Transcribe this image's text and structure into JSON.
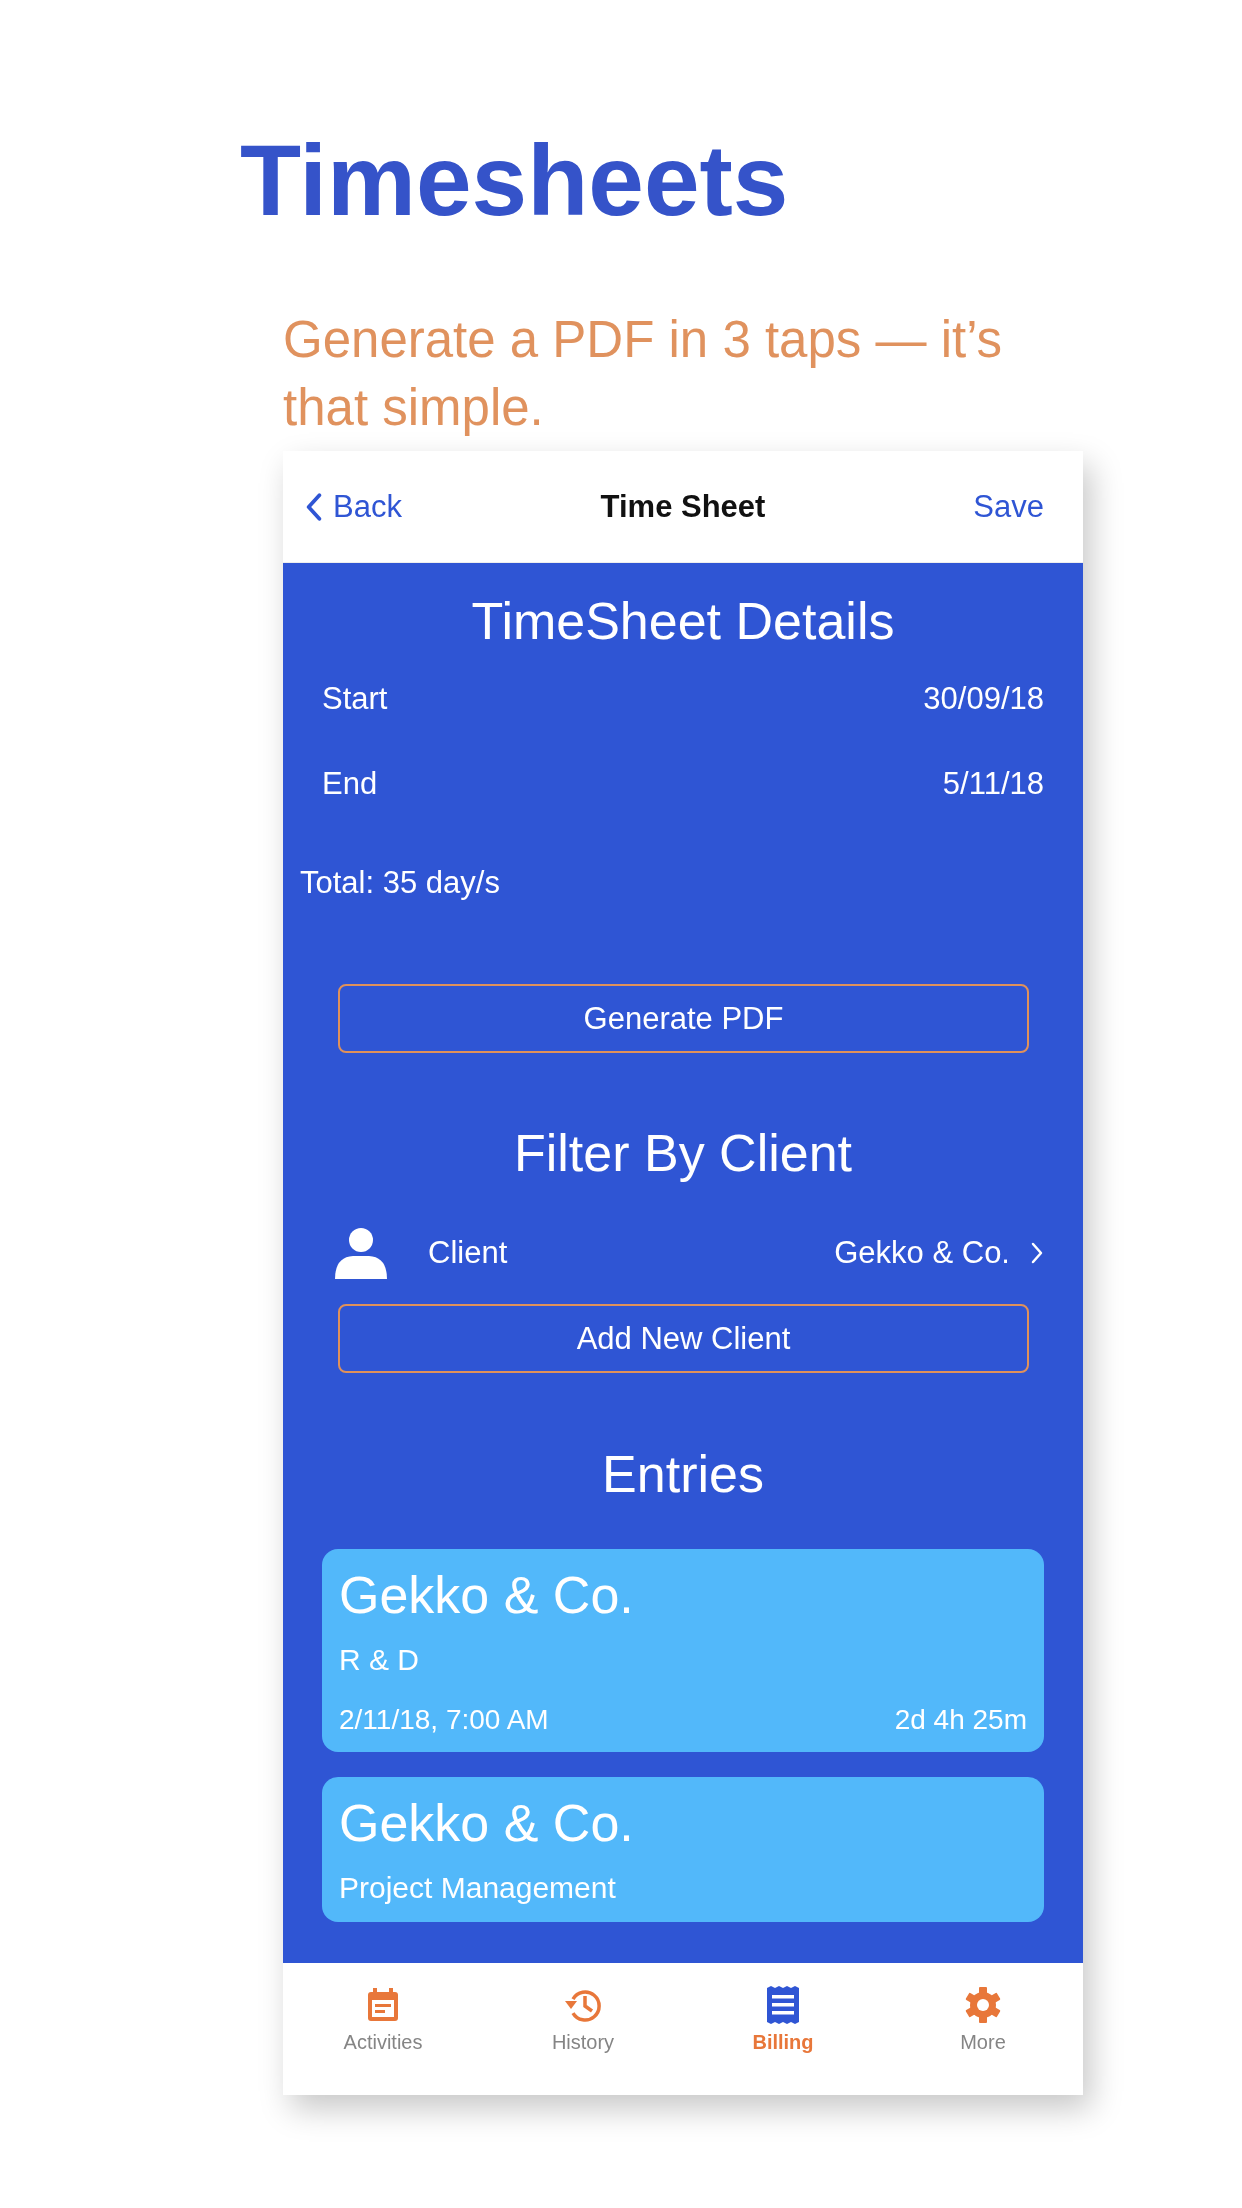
{
  "headline": "Timesheets",
  "subtitle": "Generate a PDF in 3 taps — it’s that simple.",
  "nav": {
    "back": "Back",
    "title": "Time Sheet",
    "action": "Save"
  },
  "details": {
    "heading": "TimeSheet Details",
    "rows": [
      {
        "label": "Start",
        "value": "30/09/18"
      },
      {
        "label": "End",
        "value": "5/11/18"
      }
    ],
    "total": "Total: 35 day/s",
    "button": "Generate PDF"
  },
  "filter": {
    "heading": "Filter By Client",
    "label": "Client",
    "value": "Gekko & Co.",
    "button": "Add New Client"
  },
  "entries": {
    "heading": "Entries",
    "items": [
      {
        "client": "Gekko & Co.",
        "project": "R & D",
        "date": "2/11/18, 7:00 AM",
        "duration": "2d 4h 25m"
      },
      {
        "client": "Gekko & Co.",
        "project": "Project Management"
      }
    ]
  },
  "tabs": [
    {
      "kind": "calendar",
      "label": "Activities",
      "selected": false
    },
    {
      "kind": "history",
      "label": "History",
      "selected": false
    },
    {
      "kind": "billing",
      "label": "Billing",
      "selected": true
    },
    {
      "kind": "more",
      "label": "More",
      "selected": false
    }
  ]
}
